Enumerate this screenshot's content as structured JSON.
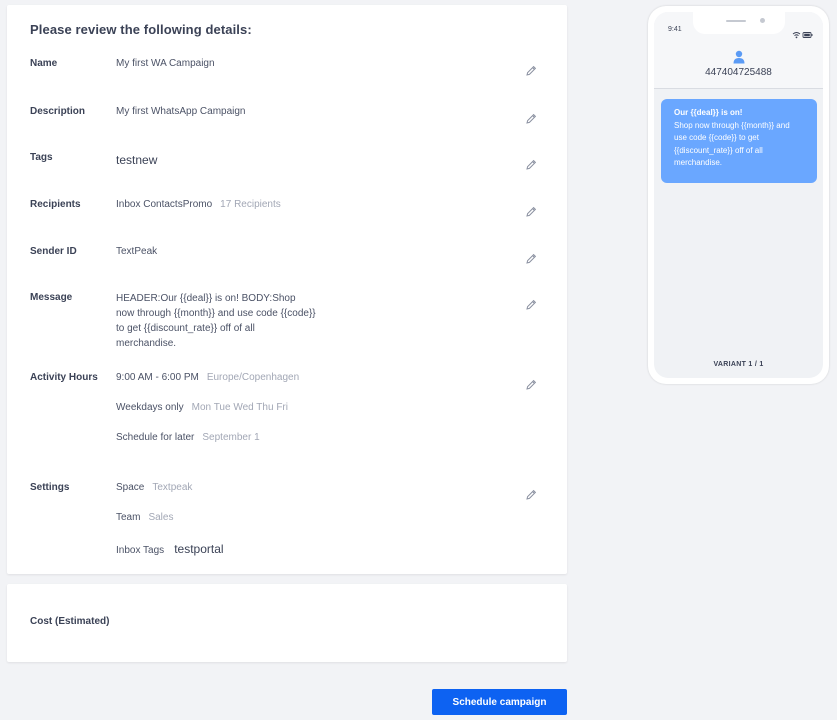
{
  "review": {
    "heading": "Please review the following details:",
    "name": {
      "label": "Name",
      "value": "My first WA Campaign"
    },
    "description": {
      "label": "Description",
      "value": "My first WhatsApp Campaign"
    },
    "tags": {
      "label": "Tags",
      "value": "testnew"
    },
    "recipients": {
      "label": "Recipients",
      "value": "Inbox ContactsPromo",
      "count": "17 Recipients"
    },
    "sender": {
      "label": "Sender ID",
      "value": "TextPeak"
    },
    "message": {
      "label": "Message",
      "value": "HEADER:Our {{deal}} is on! BODY:Shop now through {{month}} and use code {{code}} to get {{discount_rate}} off of all merchandise."
    },
    "activity": {
      "label": "Activity Hours",
      "hours": "9:00 AM - 6:00 PM",
      "timezone": "Europe/Copenhagen",
      "days_label": "Weekdays only",
      "days": "Mon Tue Wed Thu Fri",
      "schedule_label": "Schedule for later",
      "schedule_date": "September 1"
    },
    "settings": {
      "label": "Settings",
      "space_label": "Space",
      "space": "Textpeak",
      "team_label": "Team",
      "team": "Sales",
      "inbox_tags_label": "Inbox Tags",
      "inbox_tags": "testportal"
    }
  },
  "cost": {
    "label": "Cost (Estimated)"
  },
  "actions": {
    "schedule_label": "Schedule campaign"
  },
  "preview": {
    "time": "9:41",
    "phone_number": "447404725488",
    "bubble_header": "Our {{deal}} is on!",
    "bubble_body": "Shop now through {{month}} and use code {{code}} to get {{discount_rate}} off of all merchandise.",
    "variant": "VARIANT 1 / 1"
  },
  "icons": {
    "edit": "pencil-icon",
    "avatar": "user-icon",
    "wifi": "wifi-icon",
    "battery": "battery-icon"
  },
  "colors": {
    "primary": "#0d62f2",
    "bubble": "#6aa7ff",
    "muted": "#a2a7b5",
    "text": "#3b4256"
  }
}
